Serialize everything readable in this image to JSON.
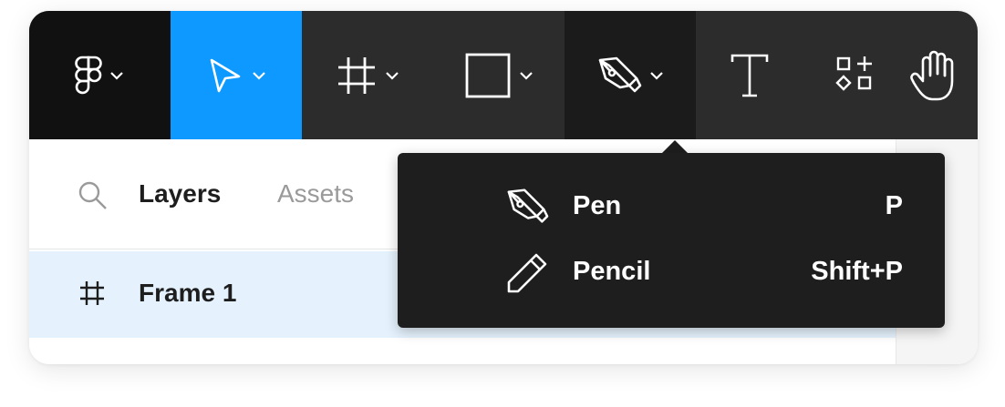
{
  "toolbar": {
    "tools": [
      {
        "name": "main-menu",
        "icon": "figma-logo-icon",
        "has_dropdown": true
      },
      {
        "name": "move",
        "icon": "move-arrow-icon",
        "has_dropdown": true,
        "active": true
      },
      {
        "name": "frame",
        "icon": "frame-hash-icon",
        "has_dropdown": true
      },
      {
        "name": "shape",
        "icon": "rectangle-icon",
        "has_dropdown": true
      },
      {
        "name": "pen",
        "icon": "pen-nib-icon",
        "has_dropdown": true,
        "open": true
      },
      {
        "name": "text",
        "icon": "text-T-icon",
        "has_dropdown": false
      },
      {
        "name": "resources",
        "icon": "resources-shapes-icon",
        "has_dropdown": false
      },
      {
        "name": "hand",
        "icon": "hand-icon",
        "has_dropdown": false
      }
    ],
    "colors": {
      "bar": "#2c2c2c",
      "menu_bg": "#111111",
      "active": "#0d99ff",
      "pen_bg": "#1b1b1b"
    }
  },
  "panel": {
    "search_icon": "search-icon",
    "tabs": [
      {
        "label": "Layers",
        "active": true
      },
      {
        "label": "Assets",
        "active": false
      }
    ],
    "layers": [
      {
        "label": "Frame 1",
        "icon": "frame-hash-icon",
        "selected": true
      }
    ],
    "selected_row_color": "#e5f2fd"
  },
  "pen_menu": {
    "items": [
      {
        "label": "Pen",
        "shortcut": "P",
        "icon": "pen-nib-icon"
      },
      {
        "label": "Pencil",
        "shortcut": "Shift+P",
        "icon": "pencil-icon"
      }
    ],
    "bg_color": "#1e1e1e"
  }
}
